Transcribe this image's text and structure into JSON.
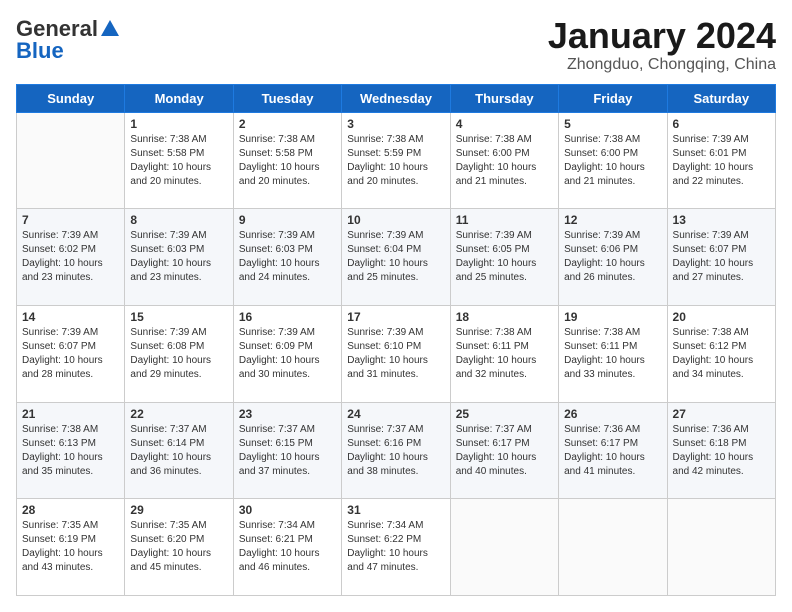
{
  "header": {
    "logo_general": "General",
    "logo_blue": "Blue",
    "month_title": "January 2024",
    "location": "Zhongduo, Chongqing, China"
  },
  "weekdays": [
    "Sunday",
    "Monday",
    "Tuesday",
    "Wednesday",
    "Thursday",
    "Friday",
    "Saturday"
  ],
  "weeks": [
    [
      {
        "day": "",
        "info": ""
      },
      {
        "day": "1",
        "info": "Sunrise: 7:38 AM\nSunset: 5:58 PM\nDaylight: 10 hours\nand 20 minutes."
      },
      {
        "day": "2",
        "info": "Sunrise: 7:38 AM\nSunset: 5:58 PM\nDaylight: 10 hours\nand 20 minutes."
      },
      {
        "day": "3",
        "info": "Sunrise: 7:38 AM\nSunset: 5:59 PM\nDaylight: 10 hours\nand 20 minutes."
      },
      {
        "day": "4",
        "info": "Sunrise: 7:38 AM\nSunset: 6:00 PM\nDaylight: 10 hours\nand 21 minutes."
      },
      {
        "day": "5",
        "info": "Sunrise: 7:38 AM\nSunset: 6:00 PM\nDaylight: 10 hours\nand 21 minutes."
      },
      {
        "day": "6",
        "info": "Sunrise: 7:39 AM\nSunset: 6:01 PM\nDaylight: 10 hours\nand 22 minutes."
      }
    ],
    [
      {
        "day": "7",
        "info": "Sunrise: 7:39 AM\nSunset: 6:02 PM\nDaylight: 10 hours\nand 23 minutes."
      },
      {
        "day": "8",
        "info": "Sunrise: 7:39 AM\nSunset: 6:03 PM\nDaylight: 10 hours\nand 23 minutes."
      },
      {
        "day": "9",
        "info": "Sunrise: 7:39 AM\nSunset: 6:03 PM\nDaylight: 10 hours\nand 24 minutes."
      },
      {
        "day": "10",
        "info": "Sunrise: 7:39 AM\nSunset: 6:04 PM\nDaylight: 10 hours\nand 25 minutes."
      },
      {
        "day": "11",
        "info": "Sunrise: 7:39 AM\nSunset: 6:05 PM\nDaylight: 10 hours\nand 25 minutes."
      },
      {
        "day": "12",
        "info": "Sunrise: 7:39 AM\nSunset: 6:06 PM\nDaylight: 10 hours\nand 26 minutes."
      },
      {
        "day": "13",
        "info": "Sunrise: 7:39 AM\nSunset: 6:07 PM\nDaylight: 10 hours\nand 27 minutes."
      }
    ],
    [
      {
        "day": "14",
        "info": "Sunrise: 7:39 AM\nSunset: 6:07 PM\nDaylight: 10 hours\nand 28 minutes."
      },
      {
        "day": "15",
        "info": "Sunrise: 7:39 AM\nSunset: 6:08 PM\nDaylight: 10 hours\nand 29 minutes."
      },
      {
        "day": "16",
        "info": "Sunrise: 7:39 AM\nSunset: 6:09 PM\nDaylight: 10 hours\nand 30 minutes."
      },
      {
        "day": "17",
        "info": "Sunrise: 7:39 AM\nSunset: 6:10 PM\nDaylight: 10 hours\nand 31 minutes."
      },
      {
        "day": "18",
        "info": "Sunrise: 7:38 AM\nSunset: 6:11 PM\nDaylight: 10 hours\nand 32 minutes."
      },
      {
        "day": "19",
        "info": "Sunrise: 7:38 AM\nSunset: 6:11 PM\nDaylight: 10 hours\nand 33 minutes."
      },
      {
        "day": "20",
        "info": "Sunrise: 7:38 AM\nSunset: 6:12 PM\nDaylight: 10 hours\nand 34 minutes."
      }
    ],
    [
      {
        "day": "21",
        "info": "Sunrise: 7:38 AM\nSunset: 6:13 PM\nDaylight: 10 hours\nand 35 minutes."
      },
      {
        "day": "22",
        "info": "Sunrise: 7:37 AM\nSunset: 6:14 PM\nDaylight: 10 hours\nand 36 minutes."
      },
      {
        "day": "23",
        "info": "Sunrise: 7:37 AM\nSunset: 6:15 PM\nDaylight: 10 hours\nand 37 minutes."
      },
      {
        "day": "24",
        "info": "Sunrise: 7:37 AM\nSunset: 6:16 PM\nDaylight: 10 hours\nand 38 minutes."
      },
      {
        "day": "25",
        "info": "Sunrise: 7:37 AM\nSunset: 6:17 PM\nDaylight: 10 hours\nand 40 minutes."
      },
      {
        "day": "26",
        "info": "Sunrise: 7:36 AM\nSunset: 6:17 PM\nDaylight: 10 hours\nand 41 minutes."
      },
      {
        "day": "27",
        "info": "Sunrise: 7:36 AM\nSunset: 6:18 PM\nDaylight: 10 hours\nand 42 minutes."
      }
    ],
    [
      {
        "day": "28",
        "info": "Sunrise: 7:35 AM\nSunset: 6:19 PM\nDaylight: 10 hours\nand 43 minutes."
      },
      {
        "day": "29",
        "info": "Sunrise: 7:35 AM\nSunset: 6:20 PM\nDaylight: 10 hours\nand 45 minutes."
      },
      {
        "day": "30",
        "info": "Sunrise: 7:34 AM\nSunset: 6:21 PM\nDaylight: 10 hours\nand 46 minutes."
      },
      {
        "day": "31",
        "info": "Sunrise: 7:34 AM\nSunset: 6:22 PM\nDaylight: 10 hours\nand 47 minutes."
      },
      {
        "day": "",
        "info": ""
      },
      {
        "day": "",
        "info": ""
      },
      {
        "day": "",
        "info": ""
      }
    ]
  ]
}
